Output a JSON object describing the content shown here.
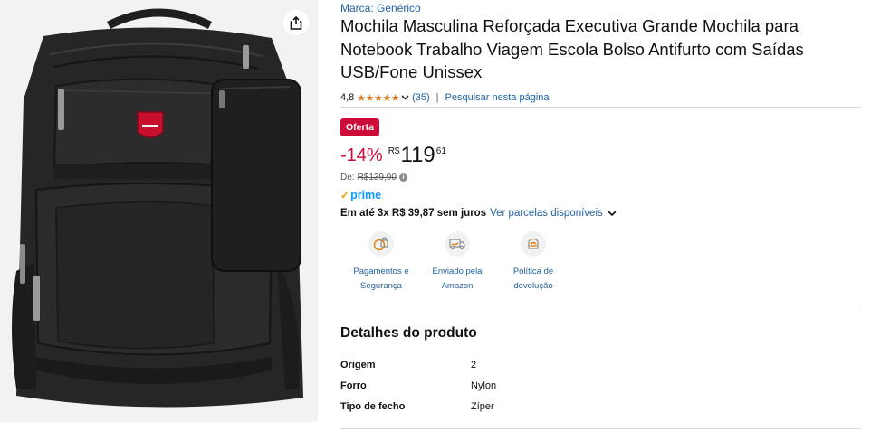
{
  "share": {
    "icon": "share-icon"
  },
  "product": {
    "brand": "Marca: Genérico",
    "title": "Mochila Masculina Reforçada Executiva Grande Mochila para Notebook Trabalho Viagem Escola Bolso Antifurto com Saídas USB/Fone Unissex",
    "rating": "4,8",
    "rating_value": 4.8,
    "stars": "★★★★★",
    "review_count": "(35)",
    "separator": "|",
    "search_link": "Pesquisar nesta página"
  },
  "pricing": {
    "deal_badge": "Oferta",
    "discount": "-14%",
    "currency": "R$",
    "whole": "119",
    "fraction": "61",
    "list_label": "De:",
    "list_price": "R$139,90",
    "prime": "prime",
    "installments_text": "Em até 3x R$ 39,87 sem juros",
    "installments_link": "Ver parcelas disponíveis"
  },
  "features": [
    {
      "line1": "Pagamentos e",
      "line2": "Segurança",
      "icon": "secure-payment-icon"
    },
    {
      "line1": "Enviado pela",
      "line2": "Amazon",
      "icon": "delivery-truck-icon"
    },
    {
      "line1": "Política de",
      "line2": "devolução",
      "icon": "return-policy-icon"
    }
  ],
  "details": {
    "title": "Detalhes do produto",
    "rows": [
      {
        "key": "Origem",
        "value": "2"
      },
      {
        "key": "Forro",
        "value": "Nylon"
      },
      {
        "key": "Tipo de fecho",
        "value": "Zíper"
      }
    ]
  },
  "colors": {
    "link": "#2162a1",
    "deal": "#cc0c39",
    "stars": "#de7921",
    "prime": "#1399ff"
  }
}
